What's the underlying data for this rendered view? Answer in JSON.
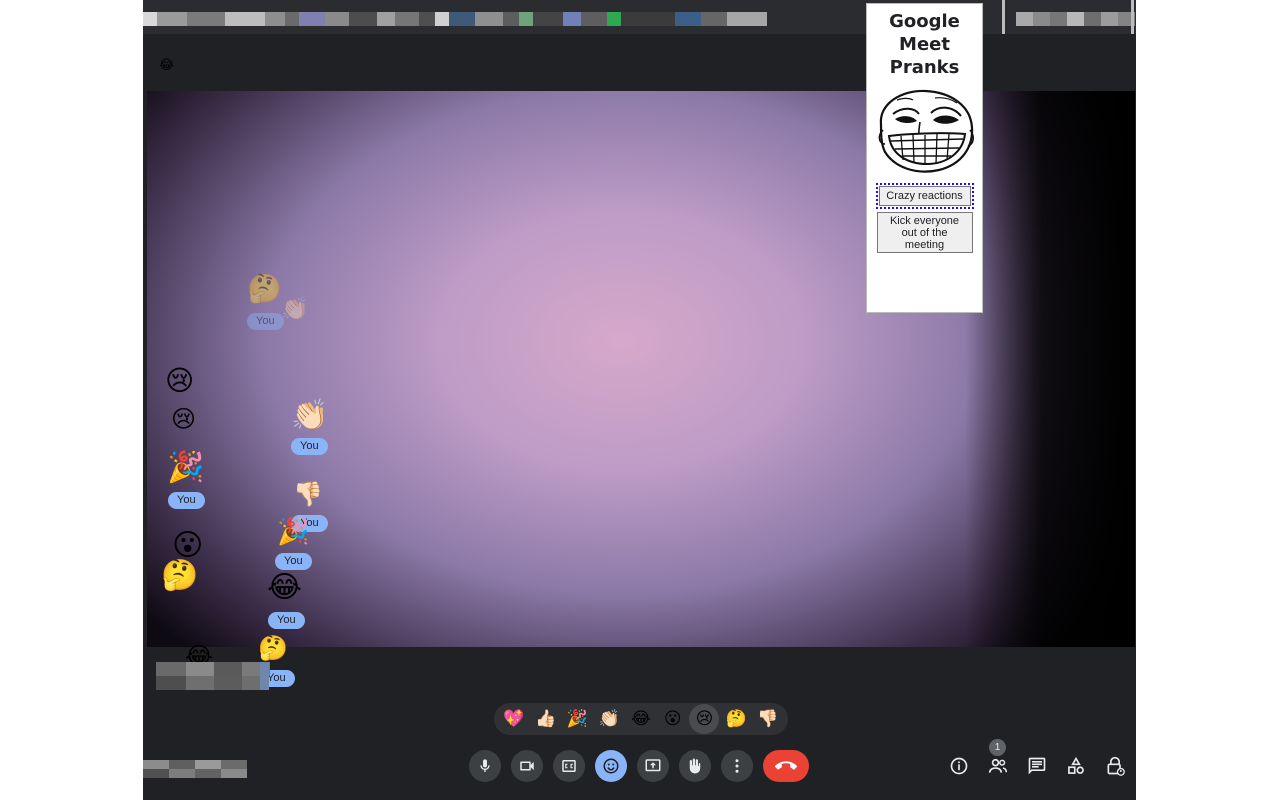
{
  "app": {
    "title_emoji": "😂",
    "tabstrip_blocks": [
      {
        "color": "#d9d9d9"
      },
      {
        "color": "#9a9a9a"
      },
      {
        "color": "#7b7b7b"
      },
      {
        "color": "#bdbdbd"
      },
      {
        "color": "#8e8e8e"
      },
      {
        "color": "#6a6a6a"
      },
      {
        "color": "#7f7fb0"
      },
      {
        "color": "#8a8a8a"
      },
      {
        "color": "#4d4d4d"
      },
      {
        "color": "#a0a0a0"
      },
      {
        "color": "#767676"
      },
      {
        "color": "#4f4f4f"
      },
      {
        "color": "#d0d0d0"
      },
      {
        "color": "#3e5a78"
      },
      {
        "color": "#8f8f8f"
      },
      {
        "color": "#5d5d5d"
      },
      {
        "color": "#6fa47b"
      },
      {
        "color": "#444444"
      },
      {
        "color": "#7080b8"
      },
      {
        "color": "#5e5e5e"
      },
      {
        "color": "#2fa84f"
      },
      {
        "color": "#3b3b3b"
      },
      {
        "color": "#3c5f8a"
      },
      {
        "color": "#666666"
      },
      {
        "color": "#a6a6a6"
      }
    ]
  },
  "video": {
    "floating_reactions": [
      {
        "emoji": "🤔",
        "faded": true
      },
      {
        "emoji": "👏🏻",
        "faded": true
      },
      {
        "emoji": "😢",
        "faded": false
      },
      {
        "emoji": "😢",
        "faded": false
      },
      {
        "emoji": "👏🏻",
        "faded": false
      },
      {
        "emoji": "🎉",
        "faded": false
      },
      {
        "emoji": "👎🏻",
        "faded": false
      },
      {
        "emoji": "🎉",
        "faded": false
      },
      {
        "emoji": "😮",
        "faded": false
      },
      {
        "emoji": "🤔",
        "faded": false
      },
      {
        "emoji": "😂",
        "faded": false
      },
      {
        "emoji": "😂",
        "faded": false
      },
      {
        "emoji": "🤔",
        "faded": false
      }
    ],
    "you_label": "You"
  },
  "reaction_bar": {
    "items": [
      {
        "emoji": "💖",
        "name": "sparkling-heart"
      },
      {
        "emoji": "👍🏻",
        "name": "thumbs-up"
      },
      {
        "emoji": "🎉",
        "name": "party-popper"
      },
      {
        "emoji": "👏🏻",
        "name": "clapping-hands"
      },
      {
        "emoji": "😂",
        "name": "tears-of-joy"
      },
      {
        "emoji": "😮",
        "name": "surprised-face"
      },
      {
        "emoji": "😢",
        "name": "crying-face",
        "selected": true
      },
      {
        "emoji": "🤔",
        "name": "thinking-face"
      },
      {
        "emoji": "👎🏻",
        "name": "thumbs-down"
      }
    ]
  },
  "controls": {
    "mic_icon": "microphone-icon",
    "camera_icon": "video-camera-icon",
    "captions_icon": "closed-captions-icon",
    "reactions_icon": "smiley-icon",
    "present_icon": "present-screen-icon",
    "hand_icon": "raise-hand-icon",
    "more_icon": "more-options-icon",
    "end_icon": "end-call-icon"
  },
  "right_controls": {
    "people_count": "1"
  },
  "popup": {
    "title": "Google Meet Pranks",
    "crazy_button": "Crazy reactions",
    "kick_button": "Kick everyone out of the meeting"
  }
}
